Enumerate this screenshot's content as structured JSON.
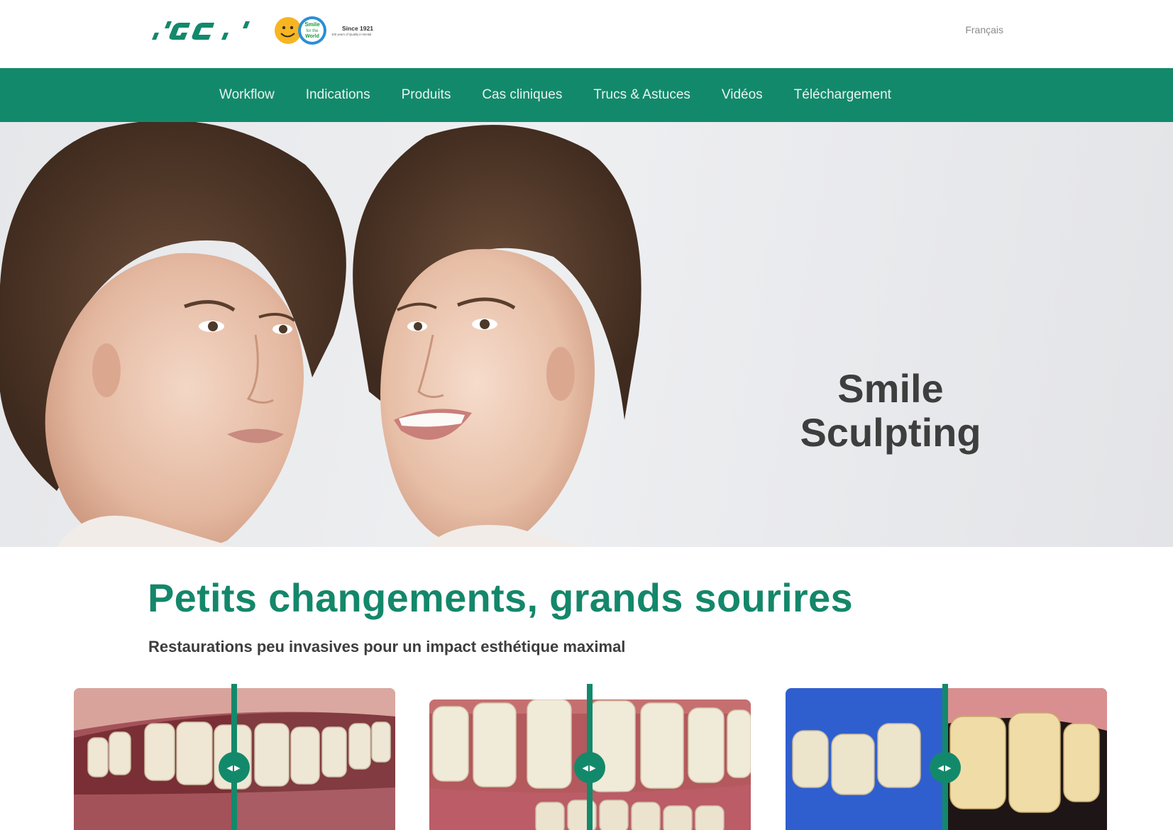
{
  "header": {
    "brand_logo": "gc-logo",
    "anniversary_badge": {
      "badge_words": [
        "Smile",
        "for the",
        "World"
      ],
      "since": "Since 1921",
      "tagline": "100 years of Quality in Dental"
    },
    "language": "Français"
  },
  "nav": {
    "items": [
      {
        "label": "Workflow"
      },
      {
        "label": "Indications"
      },
      {
        "label": "Produits"
      },
      {
        "label": "Cas cliniques"
      },
      {
        "label": "Trucs & Astuces"
      },
      {
        "label": "Vidéos"
      },
      {
        "label": "Téléchargement"
      }
    ]
  },
  "hero": {
    "title_line1": "Smile",
    "title_line2": "Sculpting"
  },
  "intro": {
    "headline": "Petits changements, grands sourires",
    "subhead": "Restaurations peu invasives pour un impact esthétique maximal"
  },
  "comparisons": [
    {
      "handle_icon": "drag-arrows-icon",
      "handle_glyph": "◀▶"
    },
    {
      "handle_icon": "drag-arrows-icon",
      "handle_glyph": "◀▶"
    },
    {
      "handle_icon": "drag-arrows-icon",
      "handle_glyph": "◀▶"
    }
  ],
  "colors": {
    "brand_green": "#13896b",
    "headline_green": "#14876a",
    "text_dark": "#3d3d3d"
  }
}
